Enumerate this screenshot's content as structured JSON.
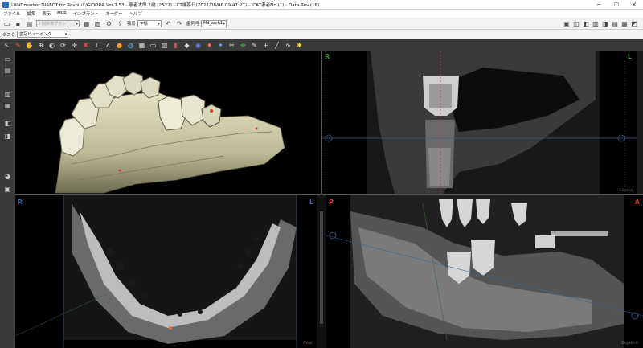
{
  "window": {
    "title": "LANDmarker DIRECT for RevoluX/GIDORA Ver.7.53 - 患者太郎 2歳 (2522) - CT撮影日(2021/08/06 09:47:27) - iCAT患者No.(1) - Data Rev.(16)",
    "minimize": "─",
    "maximize": "☐",
    "close": "✕"
  },
  "menu": {
    "items": [
      "ファイル",
      "編集",
      "表示",
      "MPR",
      "インプラント",
      "オーダー",
      "ヘルプ"
    ]
  },
  "toolbar": {
    "plan_select": "Ⅱ 削除済プラン",
    "jaw_label": "顎骨",
    "jaw_value": "下顎",
    "arch_label": "歯列弓",
    "arch_value": "Md_arch1"
  },
  "task": {
    "label": "タスク",
    "value": "歯冠ビューイング"
  },
  "views": {
    "coronal": {
      "left": "R",
      "right": "L",
      "name": "Coronal"
    },
    "axial": {
      "left": "R",
      "right": "L",
      "name": "Axial"
    },
    "cross": {
      "left": "P",
      "right": "A",
      "name": "Depth=0"
    }
  },
  "colors": {
    "bone": "#c9c7a8",
    "marker_red": "#d23a2a",
    "marker_orange": "#e8701f",
    "axis_blue": "#3a5f8f"
  }
}
